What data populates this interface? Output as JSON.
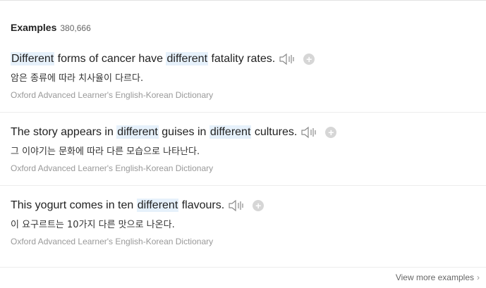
{
  "header": {
    "title": "Examples",
    "count": "380,666"
  },
  "examples": [
    {
      "segments": [
        {
          "text": "Different",
          "hl": true
        },
        {
          "text": " forms of cancer have ",
          "hl": false
        },
        {
          "text": "different",
          "hl": true
        },
        {
          "text": " fatality rates.",
          "hl": false
        }
      ],
      "korean": "암은 종류에 따라 치사율이 다르다.",
      "source": "Oxford Advanced Learner's English-Korean Dictionary"
    },
    {
      "segments": [
        {
          "text": "The story appears in ",
          "hl": false
        },
        {
          "text": "different",
          "hl": true
        },
        {
          "text": " guises in ",
          "hl": false
        },
        {
          "text": "different",
          "hl": true
        },
        {
          "text": " cultures.",
          "hl": false
        }
      ],
      "korean": "그 이야기는 문화에 따라 다른 모습으로 나타난다.",
      "source": "Oxford Advanced Learner's English-Korean Dictionary"
    },
    {
      "segments": [
        {
          "text": "This yogurt comes in ten ",
          "hl": false
        },
        {
          "text": "different",
          "hl": true
        },
        {
          "text": " flavours.",
          "hl": false
        }
      ],
      "korean": "이 요구르트는 10가지 다른 맛으로 나온다.",
      "source": "Oxford Advanced Learner's English-Korean Dictionary"
    }
  ],
  "icons": {
    "speaker": "speaker-icon",
    "add": "plus-icon",
    "chevron": "chevron-right-icon"
  },
  "colors": {
    "highlight": "#e6f1fb",
    "text": "#222222",
    "source": "#999999",
    "button_gray": "#d6d6d6"
  },
  "footer": {
    "more_label": "View more examples",
    "chevron": "›"
  }
}
